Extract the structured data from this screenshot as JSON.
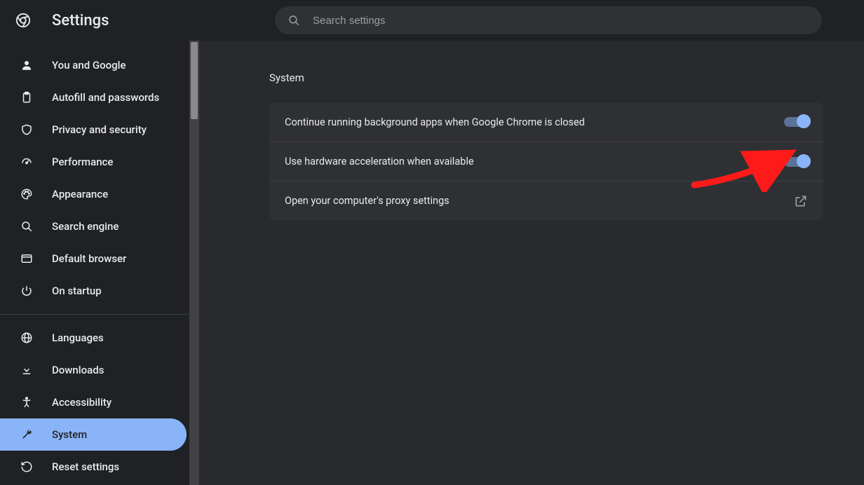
{
  "header": {
    "title": "Settings",
    "search_placeholder": "Search settings"
  },
  "sidebar": {
    "groups": [
      {
        "items": [
          {
            "id": "you-and-google",
            "icon": "person",
            "label": "You and Google",
            "active": false
          },
          {
            "id": "autofill",
            "icon": "clipboard",
            "label": "Autofill and passwords",
            "active": false
          },
          {
            "id": "privacy",
            "icon": "shield",
            "label": "Privacy and security",
            "active": false
          },
          {
            "id": "performance",
            "icon": "speed",
            "label": "Performance",
            "active": false
          },
          {
            "id": "appearance",
            "icon": "palette",
            "label": "Appearance",
            "active": false
          },
          {
            "id": "search-engine",
            "icon": "search",
            "label": "Search engine",
            "active": false
          },
          {
            "id": "default-browser",
            "icon": "browser",
            "label": "Default browser",
            "active": false
          },
          {
            "id": "on-startup",
            "icon": "power",
            "label": "On startup",
            "active": false
          }
        ]
      },
      {
        "items": [
          {
            "id": "languages",
            "icon": "globe",
            "label": "Languages",
            "active": false
          },
          {
            "id": "downloads",
            "icon": "download",
            "label": "Downloads",
            "active": false
          },
          {
            "id": "accessibility",
            "icon": "accessibility",
            "label": "Accessibility",
            "active": false
          },
          {
            "id": "system",
            "icon": "wrench",
            "label": "System",
            "active": true
          },
          {
            "id": "reset",
            "icon": "restore",
            "label": "Reset settings",
            "active": false
          }
        ]
      }
    ]
  },
  "main": {
    "section_title": "System",
    "rows": [
      {
        "id": "background-apps",
        "label": "Continue running background apps when Google Chrome is closed",
        "type": "toggle",
        "value": true
      },
      {
        "id": "hardware-accel",
        "label": "Use hardware acceleration when available",
        "type": "toggle",
        "value": true
      },
      {
        "id": "proxy",
        "label": "Open your computer's proxy settings",
        "type": "link"
      }
    ]
  },
  "colors": {
    "accent": "#8ab4f8",
    "annotation": "#ff1a1a"
  }
}
